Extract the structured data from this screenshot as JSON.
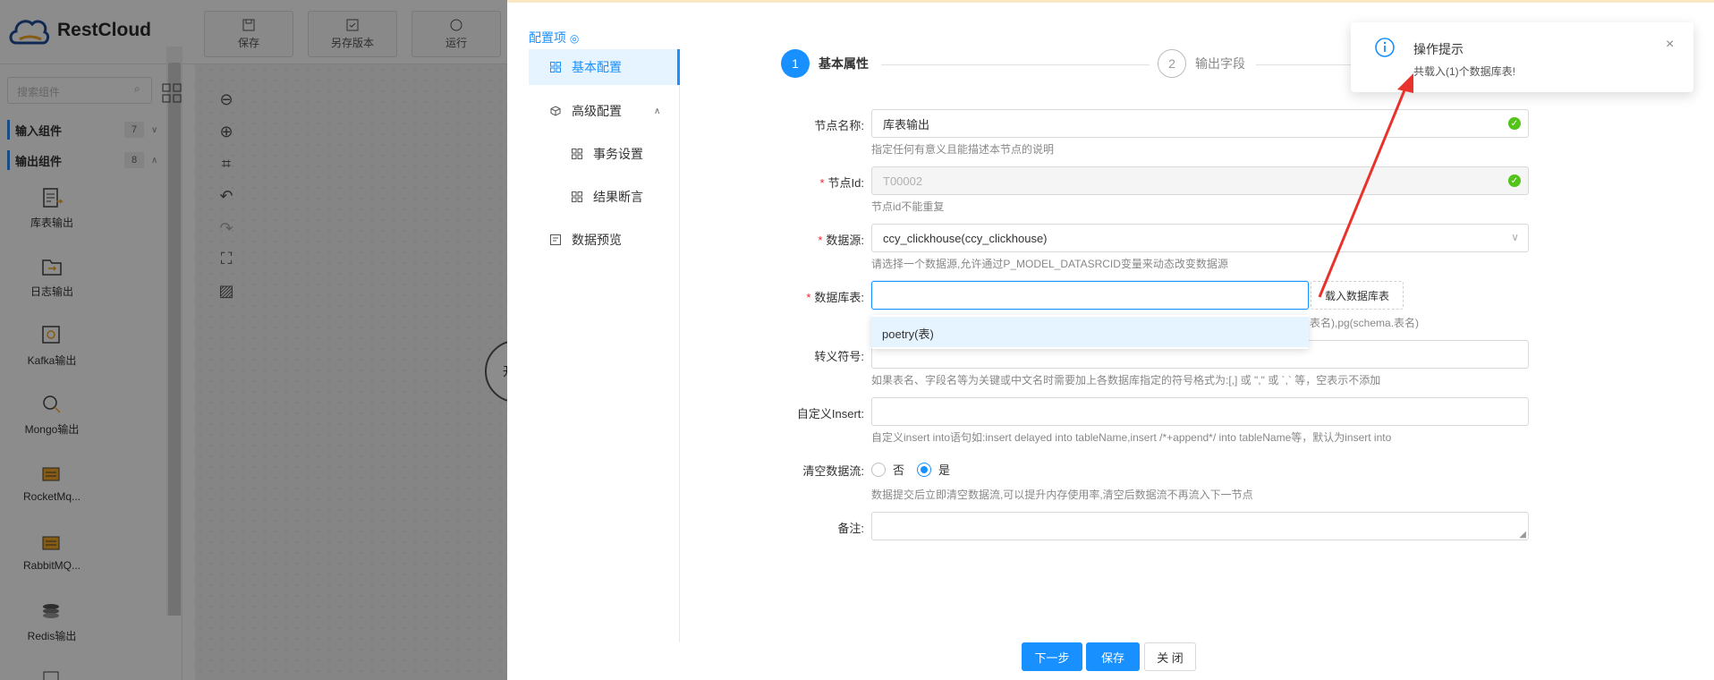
{
  "app": {
    "brand": "RestCloud",
    "toolbar": [
      {
        "label": "保存",
        "icon": "save-icon"
      },
      {
        "label": "另存版本",
        "icon": "save-version-icon"
      },
      {
        "label": "运行",
        "icon": "run-icon"
      }
    ]
  },
  "left_panel": {
    "search_placeholder": "搜索组件",
    "groups": [
      {
        "label": "输入组件",
        "count": "7",
        "arrow": "∨"
      },
      {
        "label": "输出组件",
        "count": "8",
        "arrow": "∧"
      }
    ],
    "components": [
      {
        "label": "库表输出",
        "icon": "table-output-icon"
      },
      {
        "label": "日志输出",
        "icon": "log-output-icon"
      },
      {
        "label": "Kafka输出",
        "icon": "kafka-output-icon"
      },
      {
        "label": "Mongo输出",
        "icon": "mongo-output-icon"
      },
      {
        "label": "RocketMq...",
        "icon": "rocketmq-output-icon"
      },
      {
        "label": "RabbitMQ...",
        "icon": "rabbitmq-output-icon"
      },
      {
        "label": "Redis输出",
        "icon": "redis-output-icon"
      }
    ],
    "canvas_node_text": "开"
  },
  "drawer": {
    "config_title": "配置项",
    "menu": [
      {
        "label": "基本配置",
        "active": true
      },
      {
        "label": "高级配置",
        "expand": "∧"
      },
      {
        "label": "事务设置"
      },
      {
        "label": "结果断言"
      },
      {
        "label": "数据预览"
      }
    ],
    "steps": [
      {
        "num": "1",
        "label": "基本属性"
      },
      {
        "num": "2",
        "label": "输出字段"
      }
    ],
    "form": {
      "node_name_label": "节点名称:",
      "node_name_value": "库表输出",
      "node_name_help": "指定任何有意义且能描述本节点的说明",
      "node_id_label": "节点Id:",
      "node_id_value": "T00002",
      "node_id_help": "节点id不能重复",
      "datasource_label": "数据源:",
      "datasource_value": "ccy_clickhouse(ccy_clickhouse)",
      "datasource_help": "请选择一个数据源,允许通过P_MODEL_DATASRCID变量来动态改变数据源",
      "table_label": "数据库表:",
      "table_value": "",
      "load_tables_button": "载入数据库表",
      "table_help_tail": "表名),pg(schema.表名)",
      "table_dropdown_option": "poetry(表)",
      "escape_label": "转义符号:",
      "escape_help": "如果表名、字段名等为关键或中文名时需要加上各数据库指定的符号格式为:[,] 或 \",\" 或 `,` 等，空表示不添加",
      "custom_insert_label": "自定义Insert:",
      "custom_insert_help": "自定义insert into语句如:insert delayed into tableName,insert /*+append*/ into tableName等，默认为insert into",
      "clear_stream_label": "清空数据流:",
      "radio_no": "否",
      "radio_yes": "是",
      "clear_stream_help": "数据提交后立即清空数据流,可以提升内存使用率,清空后数据流不再流入下一节点",
      "remark_label": "备注:"
    },
    "buttons": {
      "next": "下一步",
      "save": "保存",
      "close": "关 闭"
    }
  },
  "notification": {
    "title": "操作提示",
    "message": "共载入(1)个数据库表!",
    "close": "×"
  },
  "colors": {
    "accent": "#1890ff",
    "success": "#52c41a",
    "required": "#f5222d",
    "annotation_arrow": "#e8322b"
  }
}
